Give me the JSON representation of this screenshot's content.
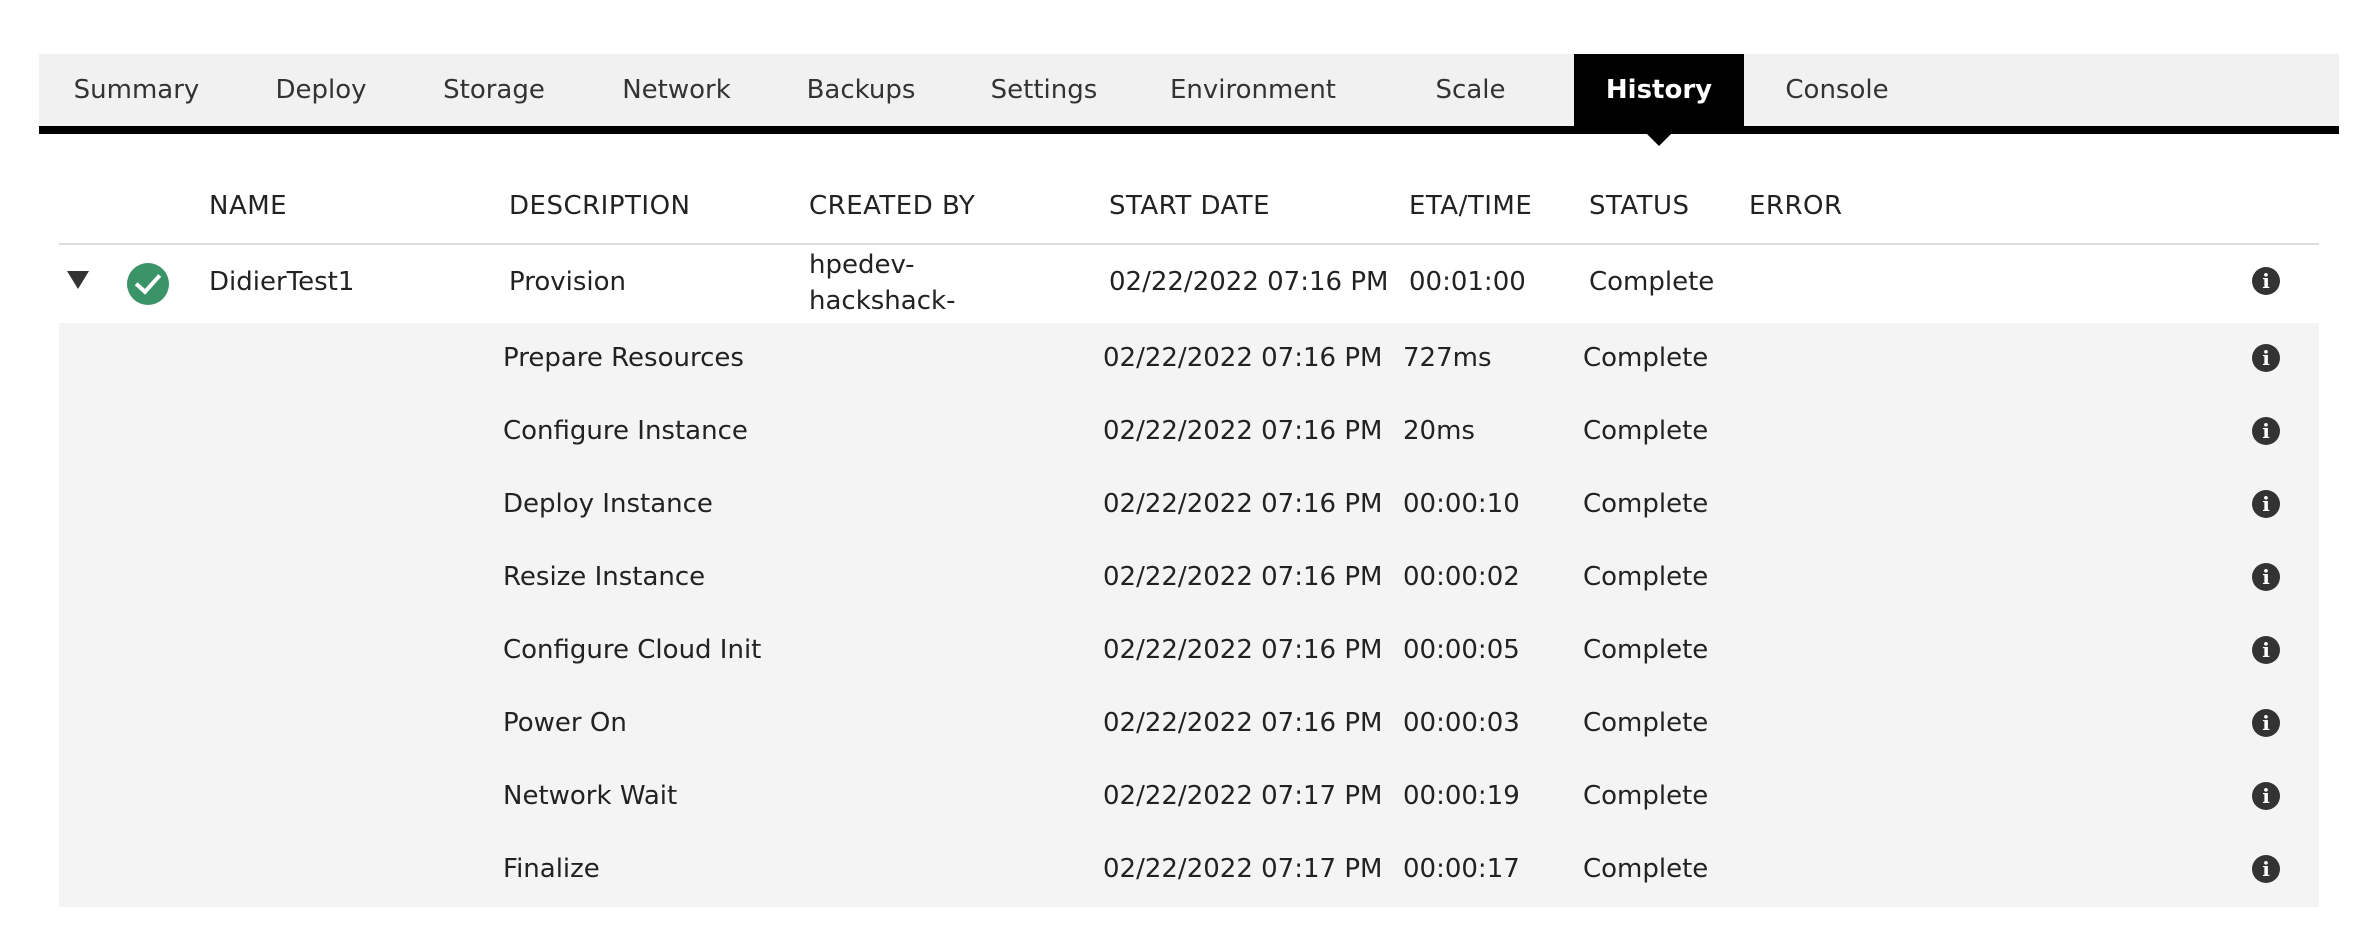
{
  "tabs": [
    {
      "label": "Summary",
      "active": false
    },
    {
      "label": "Deploy",
      "active": false
    },
    {
      "label": "Storage",
      "active": false
    },
    {
      "label": "Network",
      "active": false
    },
    {
      "label": "Backups",
      "active": false
    },
    {
      "label": "Settings",
      "active": false
    },
    {
      "label": "Environment",
      "active": false
    },
    {
      "label": "Scale",
      "active": false
    },
    {
      "label": "History",
      "active": true
    },
    {
      "label": "Console",
      "active": false
    }
  ],
  "table": {
    "headers": {
      "name": "NAME",
      "description": "DESCRIPTION",
      "created_by": "CREATED BY",
      "start_date": "START DATE",
      "eta_time": "ETA/TIME",
      "status": "STATUS",
      "error": "ERROR"
    },
    "main_row": {
      "name": "DidierTest1",
      "description": "Provision",
      "created_by": "hpedev-hackshack-terraform",
      "start_date": "02/22/2022 07:16 PM",
      "eta_time": "00:01:00",
      "status": "Complete",
      "status_icon": "check-circle-icon",
      "expand_icon": "caret-down-icon",
      "info_icon": "info-icon"
    },
    "sub_rows": [
      {
        "description": "Prepare Resources",
        "start_date": "02/22/2022 07:16 PM",
        "eta_time": "727ms",
        "status": "Complete"
      },
      {
        "description": "Configure Instance",
        "start_date": "02/22/2022 07:16 PM",
        "eta_time": "20ms",
        "status": "Complete"
      },
      {
        "description": "Deploy Instance",
        "start_date": "02/22/2022 07:16 PM",
        "eta_time": "00:00:10",
        "status": "Complete"
      },
      {
        "description": "Resize Instance",
        "start_date": "02/22/2022 07:16 PM",
        "eta_time": "00:00:02",
        "status": "Complete"
      },
      {
        "description": "Configure Cloud Init",
        "start_date": "02/22/2022 07:16 PM",
        "eta_time": "00:00:05",
        "status": "Complete"
      },
      {
        "description": "Power On",
        "start_date": "02/22/2022 07:16 PM",
        "eta_time": "00:00:03",
        "status": "Complete"
      },
      {
        "description": "Network Wait",
        "start_date": "02/22/2022 07:17 PM",
        "eta_time": "00:00:19",
        "status": "Complete"
      },
      {
        "description": "Finalize",
        "start_date": "02/22/2022 07:17 PM",
        "eta_time": "00:00:17",
        "status": "Complete"
      }
    ]
  },
  "colors": {
    "tab_bar_bg": "#f1f1f2",
    "active_tab_bg": "#000000",
    "success_green": "#3a9467",
    "sub_row_bg": "#f4f4f4"
  }
}
